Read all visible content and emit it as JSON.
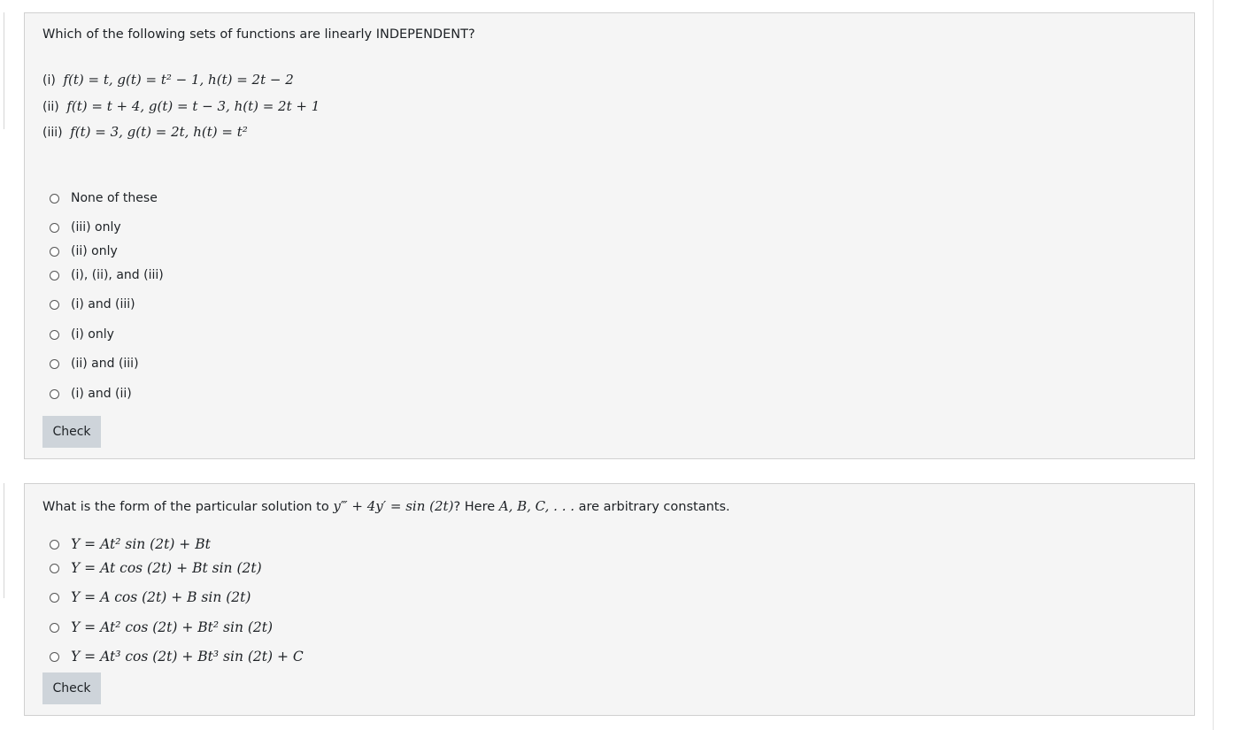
{
  "question1": {
    "prompt": "Which of the following sets of functions are linearly INDEPENDENT?",
    "sets": [
      {
        "tag": "(i)",
        "expr": "f(t) = t,  g(t) = t² − 1,  h(t) = 2t − 2"
      },
      {
        "tag": "(ii)",
        "expr": "f(t) = t + 4,  g(t) = t − 3,  h(t) = 2t + 1"
      },
      {
        "tag": "(iii)",
        "expr": "f(t) = 3,  g(t) = 2t,  h(t) = t²"
      }
    ],
    "options": [
      "None of these",
      "(iii) only",
      "(ii) only",
      "(i), (ii), and (iii)",
      "(i) and (iii)",
      "(i) only",
      "(ii) and (iii)",
      "(i) and (ii)"
    ],
    "check_label": "Check"
  },
  "question2": {
    "prompt_before": "What is the form of the particular solution to ",
    "prompt_equation": "y‴ + 4y′ = sin (2t)",
    "prompt_middle": "? Here ",
    "prompt_constants": "A, B, C, . . .",
    "prompt_after": " are arbitrary constants.",
    "options": [
      "Y = At² sin (2t) + Bt",
      "Y = At cos (2t) + Bt sin (2t)",
      "Y = A cos (2t) + B sin (2t)",
      "Y = At² cos (2t) + Bt² sin (2t)",
      "Y = At³ cos (2t) + Bt³ sin (2t) + C"
    ],
    "check_label": "Check"
  },
  "colors": {
    "card_background": "#f5f5f5",
    "card_border": "#d0d0d0",
    "button_background": "#ced4da",
    "text": "#1d2125"
  }
}
